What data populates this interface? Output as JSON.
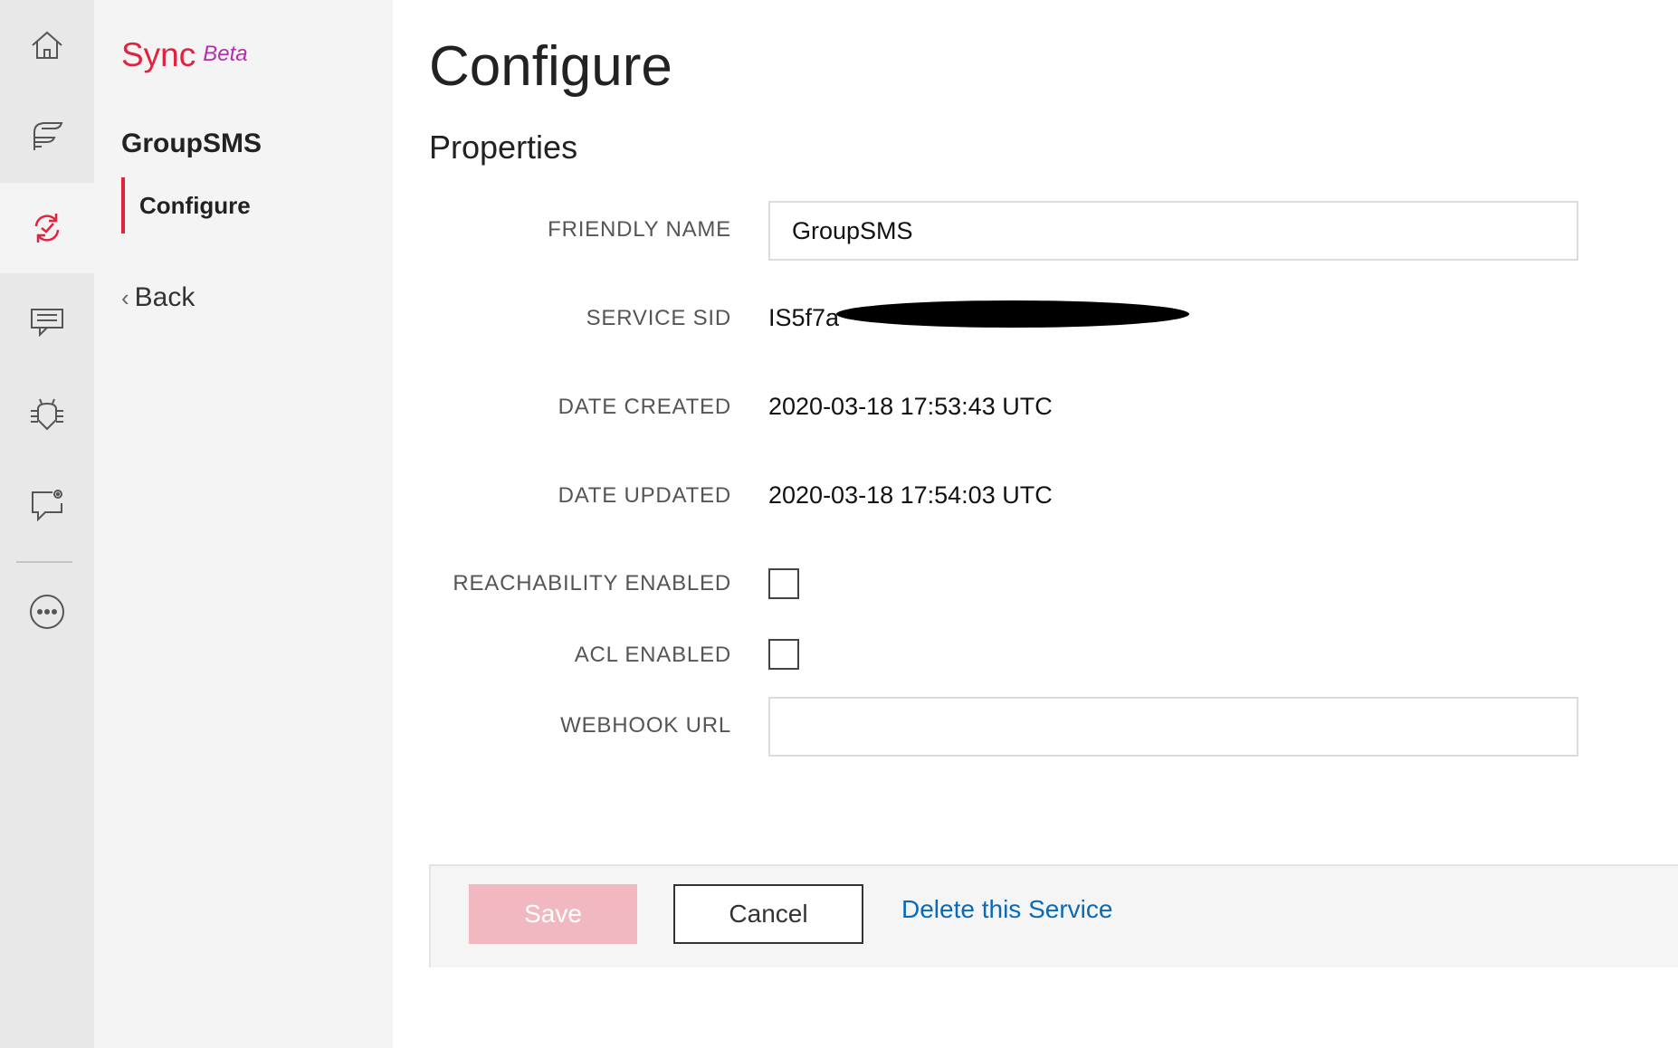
{
  "colors": {
    "brand": "#e0233f",
    "beta": "#b32fae",
    "link": "#0a6ab8",
    "save_disabled": "#f2b8c1"
  },
  "rail": {
    "items": [
      {
        "icon": "home-icon",
        "active": false
      },
      {
        "icon": "studio-icon",
        "active": false
      },
      {
        "icon": "sync-icon",
        "active": true
      },
      {
        "icon": "chat-icon",
        "active": false
      },
      {
        "icon": "debugger-icon",
        "active": false
      },
      {
        "icon": "support-chat-icon",
        "active": false
      },
      {
        "icon": "more-icon",
        "active": false
      }
    ]
  },
  "subnav": {
    "brand_name": "Sync",
    "brand_tag": "Beta",
    "service_name": "GroupSMS",
    "configure_label": "Configure",
    "back_label": "Back"
  },
  "page": {
    "title": "Configure",
    "section": "Properties"
  },
  "form": {
    "friendly_name_label": "FRIENDLY NAME",
    "friendly_name_value": "GroupSMS",
    "service_sid_label": "SERVICE SID",
    "service_sid_value": "IS5f7a",
    "date_created_label": "DATE CREATED",
    "date_created_value": "2020-03-18 17:53:43 UTC",
    "date_updated_label": "DATE UPDATED",
    "date_updated_value": "2020-03-18 17:54:03 UTC",
    "reachability_label": "REACHABILITY ENABLED",
    "acl_label": "ACL ENABLED",
    "webhook_label": "WEBHOOK URL",
    "webhook_value": ""
  },
  "footer": {
    "save_label": "Save",
    "cancel_label": "Cancel",
    "delete_label": "Delete this Service"
  }
}
